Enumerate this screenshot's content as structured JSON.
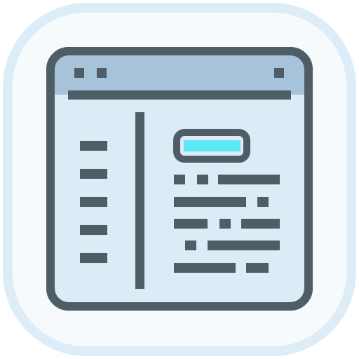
{
  "icon": {
    "name": "web-page-layout-icon",
    "colors": {
      "outer_tile": "#dcedf8",
      "inner_tile": "#f6fafc",
      "window_body": "#dcecf7",
      "title_bar": "#a6c3da",
      "stroke": "#4f5d67",
      "accent_button": "#5ce8f6"
    },
    "sidebar_line_count": 5,
    "content_row_count": 5
  }
}
